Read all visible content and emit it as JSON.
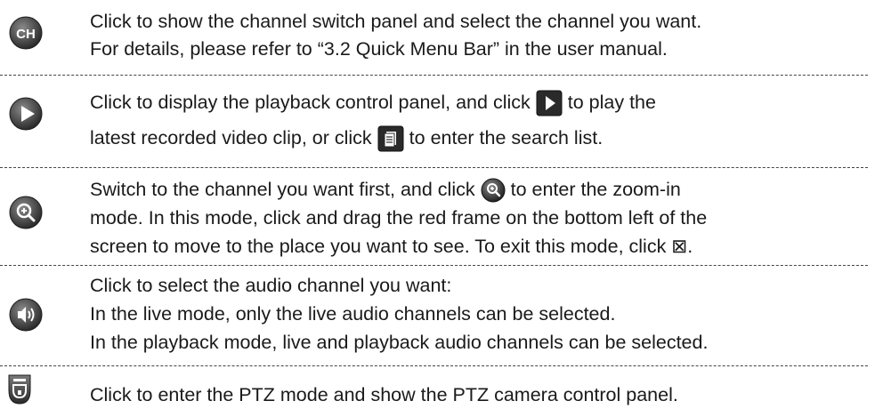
{
  "rows": [
    {
      "icon": "ch-icon",
      "badge": "CH",
      "lines": [
        "Click to show the channel switch panel and select the channel you want.",
        "For details, please refer to “3.2 Quick Menu Bar” in the user manual."
      ]
    },
    {
      "icon": "play-icon",
      "line1_a": "Click to display the playback control panel, and click",
      "line1_b": "to play the",
      "line2_a": "latest recorded video clip, or click",
      "line2_b": "to enter the search list."
    },
    {
      "icon": "zoom-in-icon",
      "line1_a": "Switch to the channel you want first, and click",
      "line1_b": "to enter the zoom-in",
      "line2": "mode. In this mode, click and drag the red frame on the bottom left of the",
      "line3": "screen to move to the place you want to see. To exit this mode, click ⊠."
    },
    {
      "icon": "audio-icon",
      "lines": [
        "Click to select the audio channel you want:",
        "In the live mode, only the live audio channels can be selected.",
        "In the playback mode, live and playback audio channels can be selected."
      ]
    },
    {
      "icon": "ptz-icon",
      "lines": [
        "Click to enter the PTZ mode and show the PTZ camera control panel."
      ]
    }
  ]
}
